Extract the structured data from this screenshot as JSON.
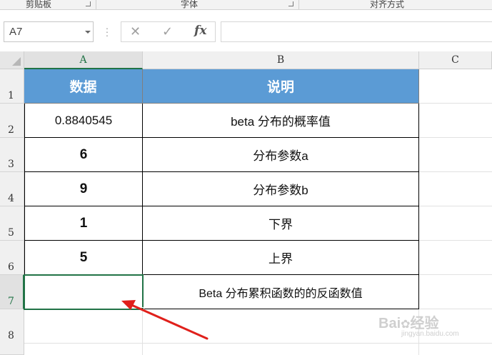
{
  "ribbon": {
    "clipboard_label": "剪贴板",
    "font_label": "字体",
    "alignment_label": "对齐方式"
  },
  "formula_bar": {
    "name_box": "A7",
    "cancel_icon": "✕",
    "enter_icon": "✓",
    "fx_label": "fx",
    "formula": ""
  },
  "columns": [
    "A",
    "B",
    "C"
  ],
  "rows": [
    "1",
    "2",
    "3",
    "4",
    "5",
    "6",
    "7",
    "8"
  ],
  "table": {
    "header": {
      "a": "数据",
      "b": "说明"
    },
    "rows": [
      {
        "a": "0.8840545",
        "b": "beta 分布的概率值"
      },
      {
        "a": "6",
        "b": "分布参数a"
      },
      {
        "a": "9",
        "b": "分布参数b"
      },
      {
        "a": "1",
        "b": "下界"
      },
      {
        "a": "5",
        "b": "上界"
      },
      {
        "a": "",
        "b": "Beta 分布累积函数的的反函数值"
      }
    ]
  },
  "colors": {
    "header_fill": "#5b9bd5",
    "selection": "#217346",
    "arrow": "#e0201b"
  },
  "watermark": {
    "brand": "Bai",
    "brand_tail": "经验",
    "url": "jingyan.baidu.com"
  }
}
